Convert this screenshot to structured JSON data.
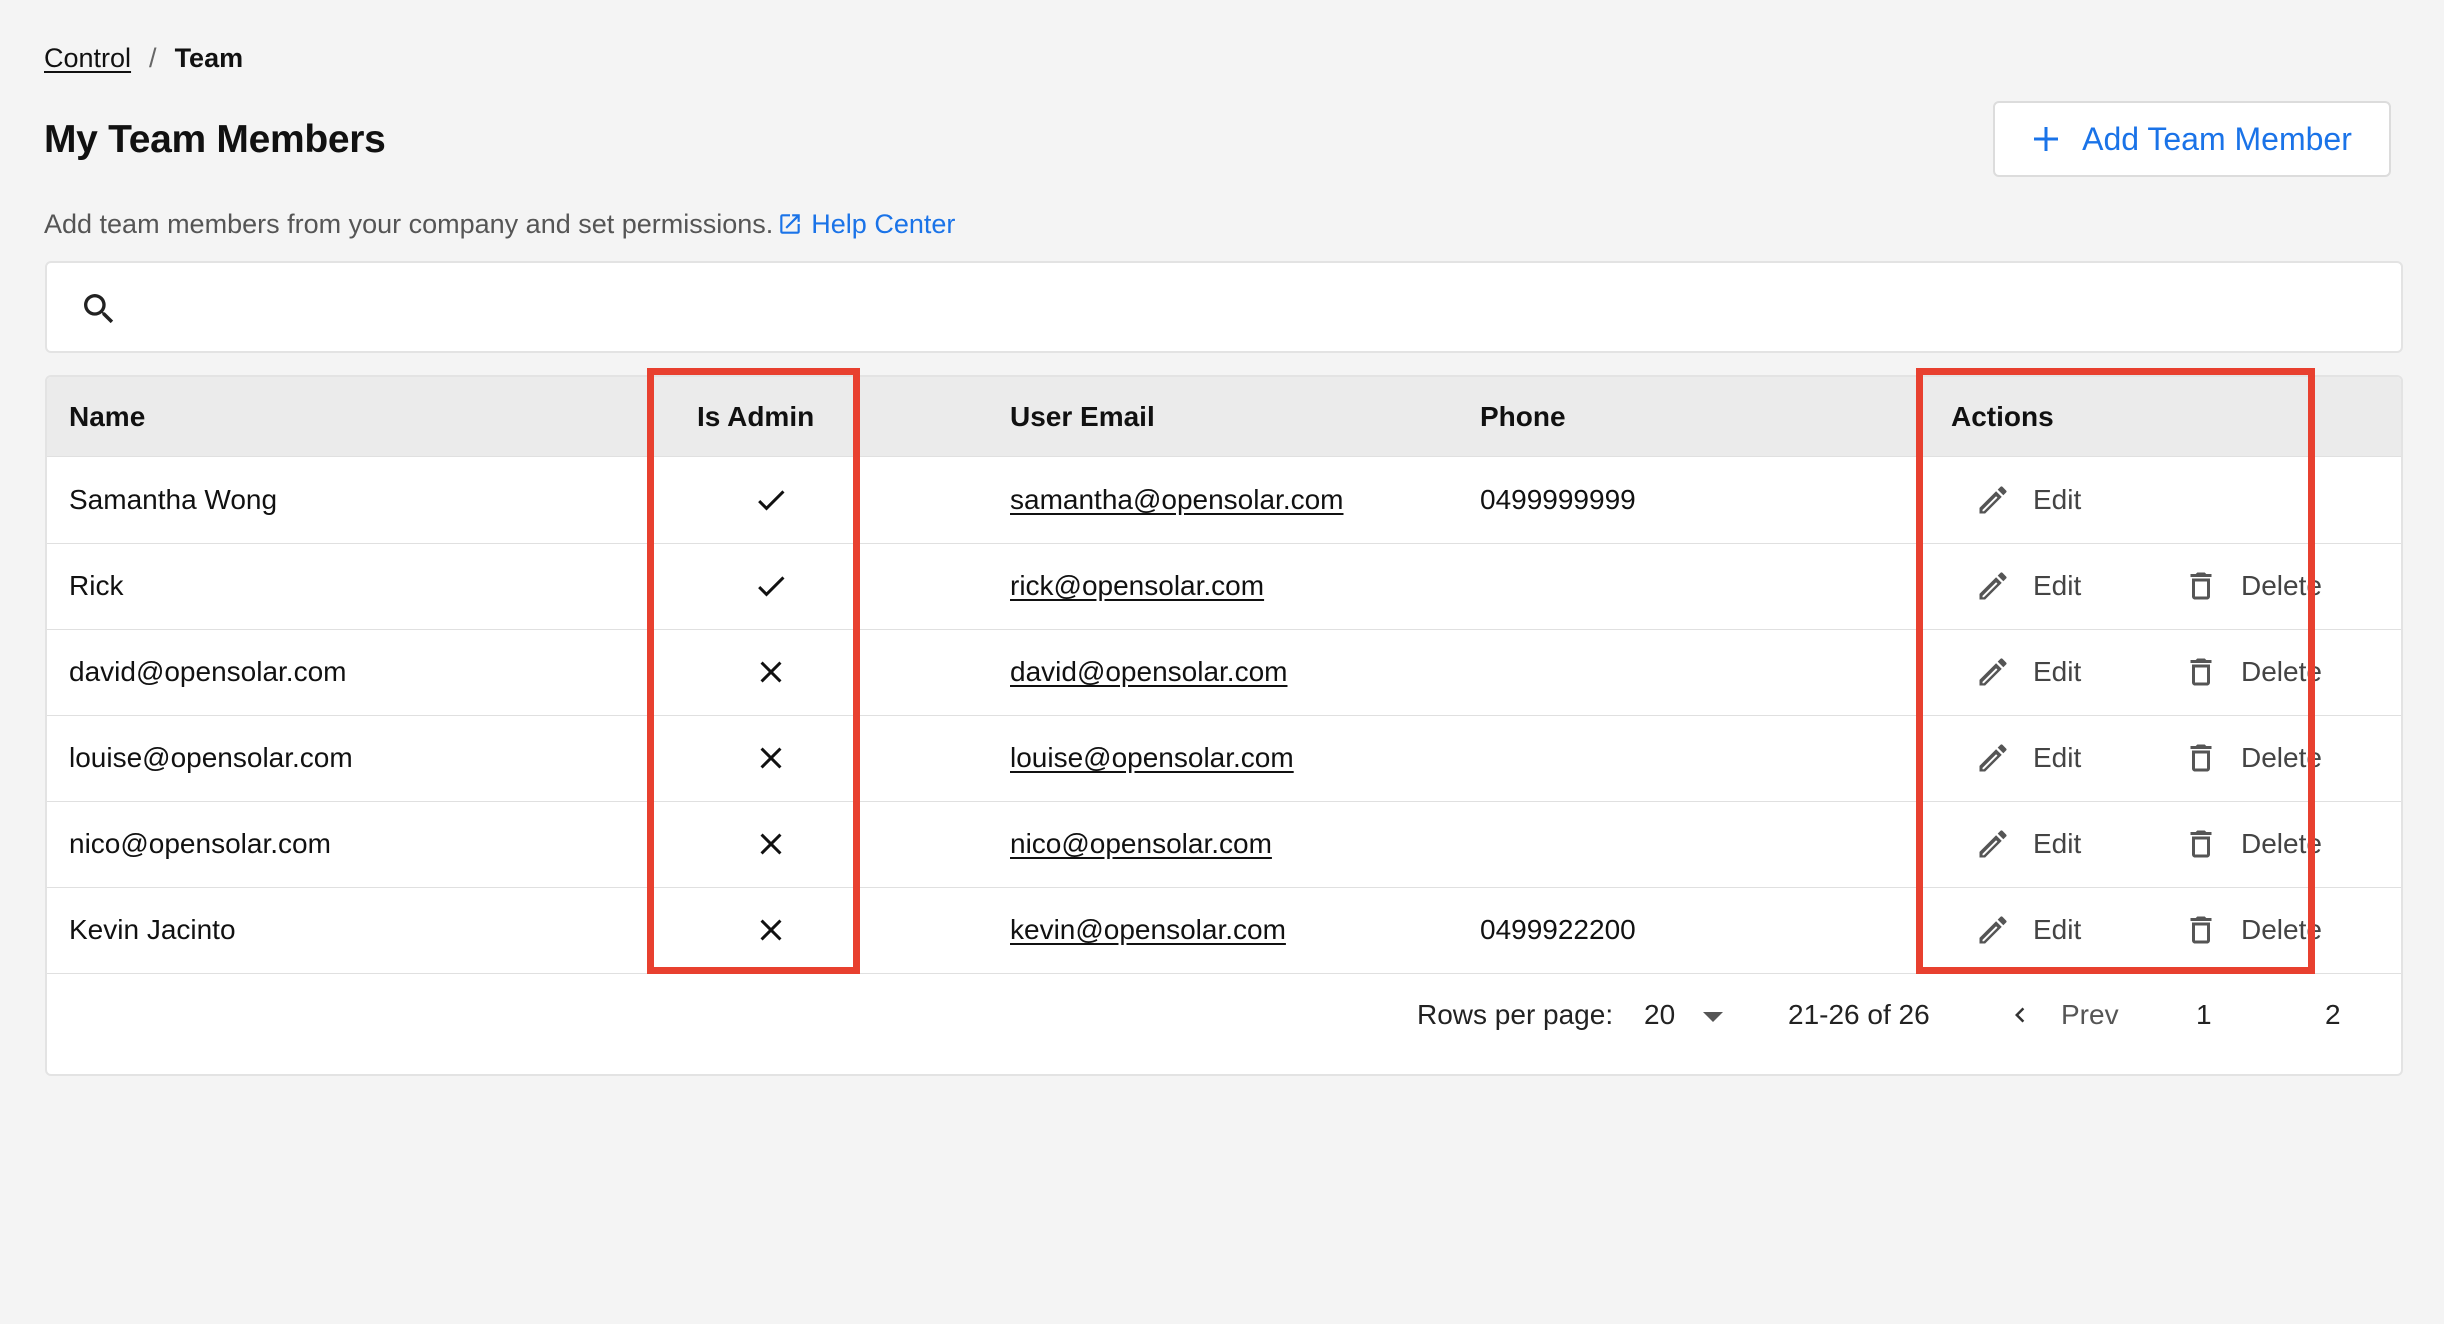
{
  "breadcrumb": {
    "parent": "Control",
    "separator": "/",
    "current": "Team"
  },
  "header": {
    "title": "My Team Members",
    "add_button_label": "Add Team Member",
    "add_button_icon": "plus-icon"
  },
  "subtitle": {
    "text": "Add team members from your company and set permissions.",
    "help_link": "Help Center",
    "help_icon": "external-link-icon"
  },
  "search": {
    "placeholder": "",
    "value": "",
    "icon": "search-icon"
  },
  "table": {
    "columns": {
      "name": "Name",
      "is_admin": "Is Admin",
      "email": "User Email",
      "phone": "Phone",
      "actions": "Actions"
    },
    "rows": [
      {
        "name": "Samantha Wong",
        "is_admin": true,
        "email": "samantha@opensolar.com",
        "phone": "0499999999",
        "can_delete": false
      },
      {
        "name": "Rick",
        "is_admin": true,
        "email": "rick@opensolar.com",
        "phone": "",
        "can_delete": true
      },
      {
        "name": "david@opensolar.com",
        "is_admin": false,
        "email": "david@opensolar.com",
        "phone": "",
        "can_delete": true
      },
      {
        "name": "louise@opensolar.com",
        "is_admin": false,
        "email": "louise@opensolar.com",
        "phone": "",
        "can_delete": true
      },
      {
        "name": "nico@opensolar.com",
        "is_admin": false,
        "email": "nico@opensolar.com",
        "phone": "",
        "can_delete": true
      },
      {
        "name": "Kevin Jacinto",
        "is_admin": false,
        "email": "kevin@opensolar.com",
        "phone": "0499922200",
        "can_delete": true
      }
    ],
    "edit_label": "Edit",
    "delete_label": "Delete"
  },
  "pagination": {
    "rows_per_page_label": "Rows per page:",
    "rows_per_page_value": "20",
    "range_text": "21-26 of 26",
    "prev_label": "Prev",
    "pages": [
      "1",
      "2"
    ]
  },
  "colors": {
    "accent": "#1a73e8",
    "highlight": "#e8402f",
    "header_bg": "#ebebeb",
    "page_bg": "#f4f4f4"
  }
}
